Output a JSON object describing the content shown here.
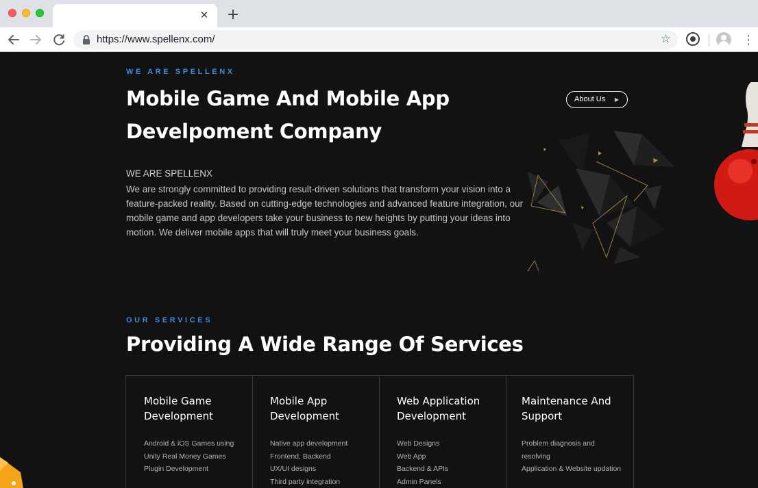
{
  "browser": {
    "url": "https://www.spellenx.com/",
    "tab_close_glyph": "✕",
    "new_tab_glyph": "+",
    "icons": [
      "back-arrow-icon",
      "forward-arrow-icon",
      "reload-icon",
      "lock-icon",
      "star-icon",
      "extension-icon",
      "profile-avatar-icon",
      "menu-dots-icon"
    ]
  },
  "hero": {
    "eyebrow": "WE ARE SPELLENX",
    "title": "Mobile Game And Mobile App Develpoment Company",
    "about_button": "About Us",
    "intro_label": "WE ARE SPELLENX",
    "intro_body": "We are strongly committed to providing result-driven solutions that transform your vision into a feature-packed reality. Based on cutting-edge technologies and advanced feature integration, our mobile game and app developers take your business to new heights by putting your ideas into motion. We deliver mobile apps that will truly meet your business goals."
  },
  "services": {
    "eyebrow": "OUR SERVICES",
    "title": "Providing A Wide Range Of Services",
    "cards": [
      {
        "title": "Mobile Game Development",
        "items": [
          "Android & iOS Games using",
          "Unity Real Money Games",
          "Plugin Development"
        ]
      },
      {
        "title": "Mobile App Development",
        "items": [
          "Native app development",
          "Frontend, Backend",
          "UX/UI designs",
          "Third party integration"
        ]
      },
      {
        "title": "Web Application Development",
        "items": [
          "Web Designs",
          "Web App",
          "Backend & APIs",
          "Admin Panels"
        ]
      },
      {
        "title": "Maintenance And Support",
        "items": [
          "Problem diagnosis and resolving",
          "Application & Website updation"
        ]
      }
    ]
  },
  "colors": {
    "page_background": "#121212",
    "accent_blue": "#3d8de0",
    "heading": "#ffffff",
    "body_text": "#c8c8c8",
    "card_border": "#3a3a3a"
  }
}
